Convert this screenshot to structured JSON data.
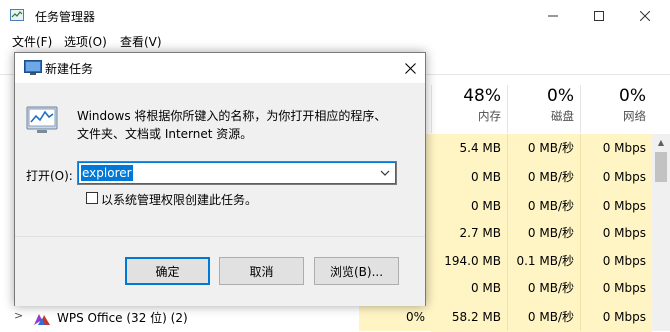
{
  "task_manager": {
    "title": "任务管理器",
    "menus": [
      "文件(F)",
      "选项(O)",
      "查看(V)"
    ],
    "columns": [
      {
        "pct": "48%",
        "name": "内存"
      },
      {
        "pct": "0%",
        "name": "磁盘"
      },
      {
        "pct": "0%",
        "name": "网络"
      }
    ],
    "rows": [
      {
        "mem": "5.4 MB",
        "disk": "0 MB/秒",
        "net": "0 Mbps"
      },
      {
        "mem": "0 MB",
        "disk": "0 MB/秒",
        "net": "0 Mbps"
      },
      {
        "mem": "0 MB",
        "disk": "0 MB/秒",
        "net": "0 Mbps"
      },
      {
        "mem": "2.7 MB",
        "disk": "0 MB/秒",
        "net": "0 Mbps"
      },
      {
        "mem": "194.0 MB",
        "disk": "0.1 MB/秒",
        "net": "0 Mbps"
      },
      {
        "mem": "0 MB",
        "disk": "0 MB/秒",
        "net": "0 Mbps"
      },
      {
        "cpu": "0%",
        "mem": "58.2 MB",
        "disk": "0 MB/秒",
        "net": "0 Mbps"
      }
    ],
    "wps_row": {
      "expand": ">",
      "label": "WPS Office (32 位) (2)"
    },
    "colors": {
      "highlight": "#fff4c4",
      "accent": "#0078d7"
    }
  },
  "run_dialog": {
    "title": "新建任务",
    "description_line1": "Windows 将根据你所键入的名称，为你打开相应的程序、",
    "description_line2": "文件夹、文档或 Internet 资源。",
    "open_label": "打开(O):",
    "open_value": "explorer",
    "admin_checkbox_label": "以系统管理权限创建此任务。",
    "admin_checked": false,
    "buttons": {
      "ok": "确定",
      "cancel": "取消",
      "browse": "浏览(B)..."
    },
    "icons": {
      "title": "run-icon",
      "body": "task-manager-run-icon",
      "close": "close-icon",
      "dropdown": "chevron-down-icon"
    }
  }
}
